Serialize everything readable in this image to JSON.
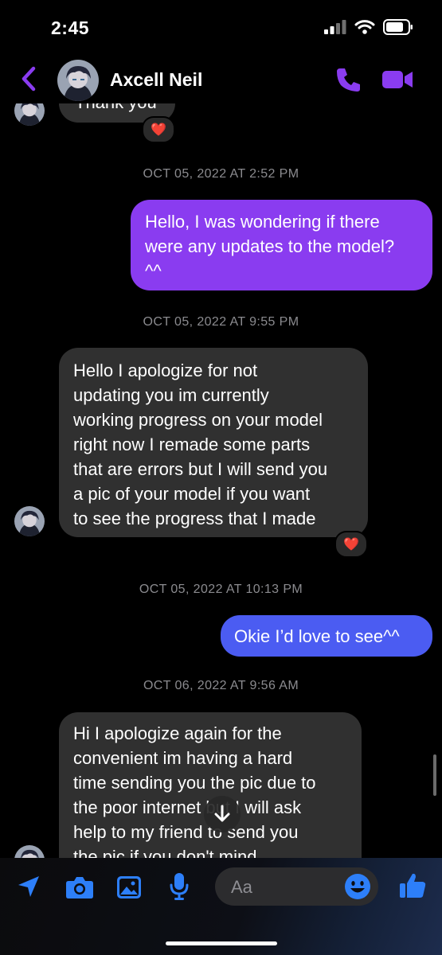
{
  "status_bar": {
    "time": "2:45"
  },
  "header": {
    "contact_name": "Axcell Neil"
  },
  "colors": {
    "accent": "#8a3cf0",
    "blue_bubble": "#4b5cf2",
    "incoming_bubble": "#303030",
    "timestamp": "#8b8b8f"
  },
  "messages": [
    {
      "sender": "them",
      "text": "Thank you",
      "reaction": "❤️"
    },
    {
      "sender": "me",
      "timestamp": "OCT 05, 2022 AT 2:52 PM",
      "lines": [
        "Hello, I was wondering if there",
        "were any updates to the model?",
        "^^"
      ]
    },
    {
      "sender": "them",
      "timestamp": "OCT 05, 2022 AT 9:55 PM",
      "lines": [
        "Hello I apologize for not",
        "updating you im currently",
        "working progress on your model",
        "right now I remade some parts",
        "that are errors but I will send you",
        "a pic of your model if you want",
        "to see the progress that I made"
      ],
      "reaction": "❤️"
    },
    {
      "sender": "me",
      "timestamp": "OCT 05, 2022 AT 10:13 PM",
      "text": "Okie I’d love to see^^"
    },
    {
      "sender": "them",
      "timestamp": "OCT 06, 2022 AT 9:56 AM",
      "lines": [
        "Hi I apologize again for the",
        "convenient im having a hard",
        "time sending you the pic due to",
        "the poor internet but I will ask",
        "help to my friend to send you",
        "the pic if you don't mind"
      ]
    }
  ],
  "composer": {
    "placeholder": "Aa",
    "icons": [
      "location-icon",
      "camera-icon",
      "gallery-icon",
      "microphone-icon",
      "emoji-icon",
      "thumbs-up-icon"
    ]
  }
}
